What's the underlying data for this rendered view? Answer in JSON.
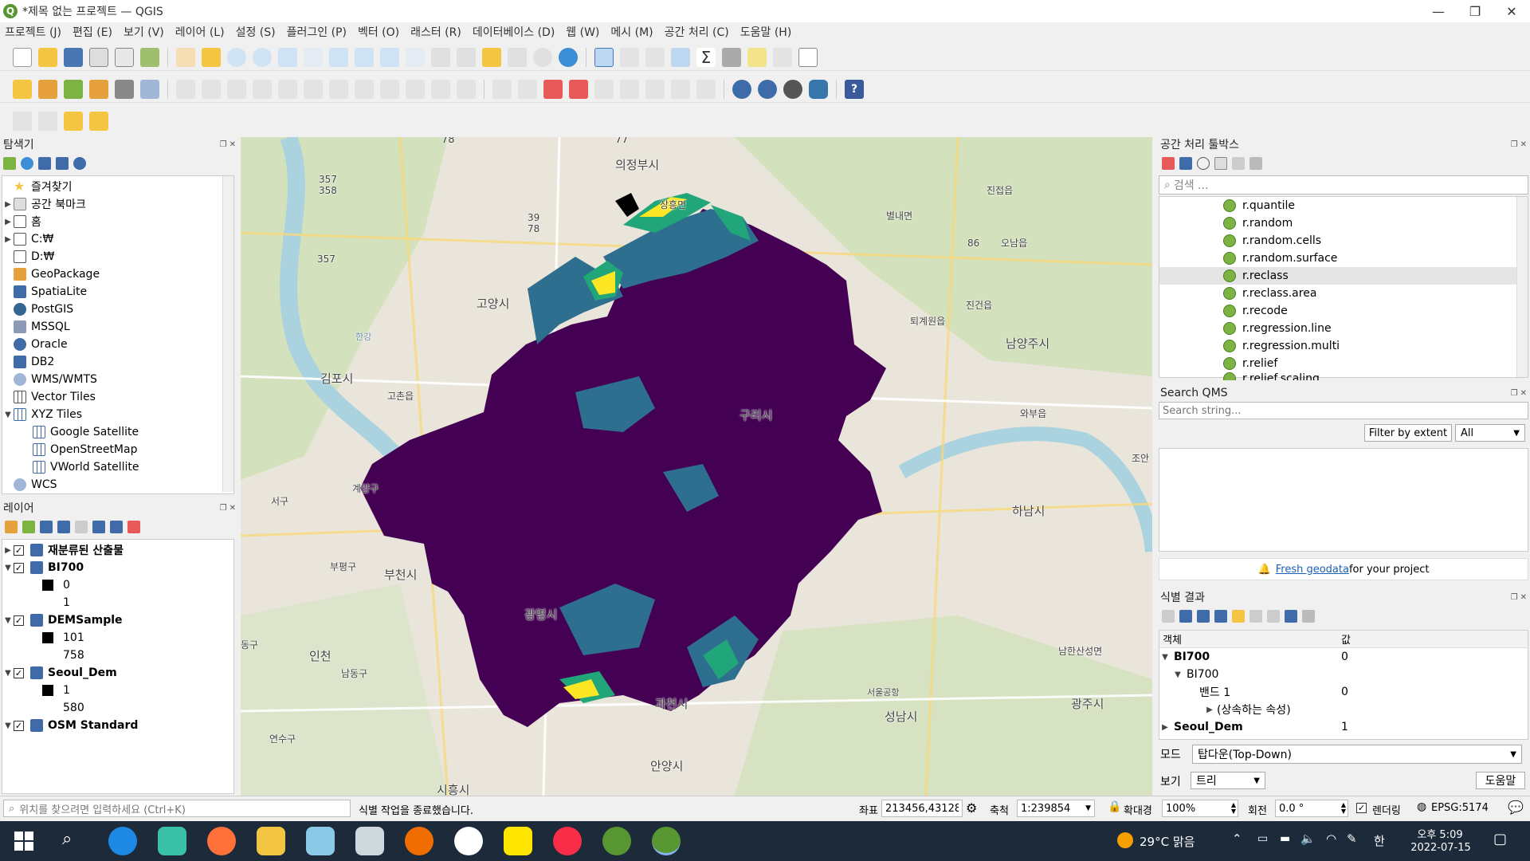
{
  "window": {
    "title": "*제목 없는 프로젝트 — QGIS",
    "minimize": "—",
    "restore": "❐",
    "close": "✕"
  },
  "menu": [
    "프로젝트 (J)",
    "편집 (E)",
    "보기 (V)",
    "레이어 (L)",
    "설정 (S)",
    "플러그인 (P)",
    "벡터 (O)",
    "래스터 (R)",
    "데이터베이스 (D)",
    "웹 (W)",
    "메시 (M)",
    "공간 처리 (C)",
    "도움말 (H)"
  ],
  "browser": {
    "title": "탐색기",
    "items": [
      "즐겨찾기",
      "공간 북마크",
      "홈",
      "C:₩",
      "D:₩",
      "GeoPackage",
      "SpatiaLite",
      "PostGIS",
      "MSSQL",
      "Oracle",
      "DB2",
      "WMS/WMTS",
      "Vector Tiles",
      "XYZ Tiles",
      "Google Satellite",
      "OpenStreetMap",
      "VWorld Satellite",
      "WCS"
    ]
  },
  "layers": {
    "title": "레이어",
    "items": [
      {
        "name": "재분류된 산출물"
      },
      {
        "name": "BI700",
        "v1": "0",
        "v2": "1"
      },
      {
        "name": "DEMSample",
        "v1": "101",
        "v2": "758"
      },
      {
        "name": "Seoul_Dem",
        "v1": "1",
        "v2": "580"
      },
      {
        "name": "OSM Standard"
      }
    ]
  },
  "map": {
    "labels": [
      "의정부시",
      "고양시",
      "남양주시",
      "김포시",
      "구리시",
      "하남시",
      "부천시",
      "인천",
      "광명시",
      "과천시",
      "성남시",
      "안양시",
      "광주시",
      "진접읍",
      "오남읍",
      "별내면",
      "장흥면",
      "퇴계원읍",
      "진건읍",
      "와부읍",
      "고촌읍",
      "계양구",
      "부평구",
      "남동구",
      "연수구",
      "서구",
      "시흥시",
      "조안",
      "남한산성면",
      "서울공항",
      "한강",
      "동구"
    ],
    "road_numbers": [
      "77",
      "78",
      "357\n358",
      "39\n78",
      "357",
      "86"
    ]
  },
  "toolbox": {
    "title": "공간 처리 툴박스",
    "search_placeholder": "검색 ...",
    "algorithms": [
      "r.quantile",
      "r.random",
      "r.random.cells",
      "r.random.surface",
      "r.reclass",
      "r.reclass.area",
      "r.recode",
      "r.regression.line",
      "r.regression.multi",
      "r.relief",
      "r.relief.scaling"
    ]
  },
  "qms": {
    "title": "Search QMS",
    "placeholder": "Search string...",
    "filter_button": "Filter by extent",
    "filter_value": "All",
    "fresh_link": "Fresh geodata",
    "fresh_suffix": " for your project"
  },
  "identify": {
    "title": "식별 결과",
    "col_feature": "객체",
    "col_value": "값",
    "rows": [
      {
        "name": "BI700",
        "value": "0"
      },
      {
        "name": "BI700",
        "value": ""
      },
      {
        "name": "밴드 1",
        "value": "0"
      },
      {
        "name": "(상속하는 속성)",
        "value": ""
      },
      {
        "name": "Seoul_Dem",
        "value": "1"
      }
    ],
    "mode_label": "모드",
    "mode_value": "탑다운(Top-Down)",
    "view_label": "보기",
    "view_value": "트리",
    "help_button": "도움말"
  },
  "status": {
    "locator_placeholder": "위치를 찾으려면 입력하세요 (Ctrl+K)",
    "message": "식별 작업을 종료했습니다.",
    "coord_label": "좌표",
    "coord_value": "213456,431285",
    "scale_label": "축척",
    "scale_value": "1:239854",
    "magnifier_label": "확대경",
    "magnifier_value": "100%",
    "rotation_label": "회전",
    "rotation_value": "0.0 °",
    "render_label": "렌더링",
    "crs": "EPSG:5174"
  },
  "taskbar": {
    "weather": "29°C  맑음",
    "ime": "한",
    "ampm_time": "오후 5:09",
    "date": "2022-07-15"
  },
  "colors": {
    "accent": "#589632",
    "raster_dark": "#44014f",
    "raster_teal": "#2e6e8e",
    "raster_green": "#21a67a",
    "raster_yellow": "#fde725"
  }
}
